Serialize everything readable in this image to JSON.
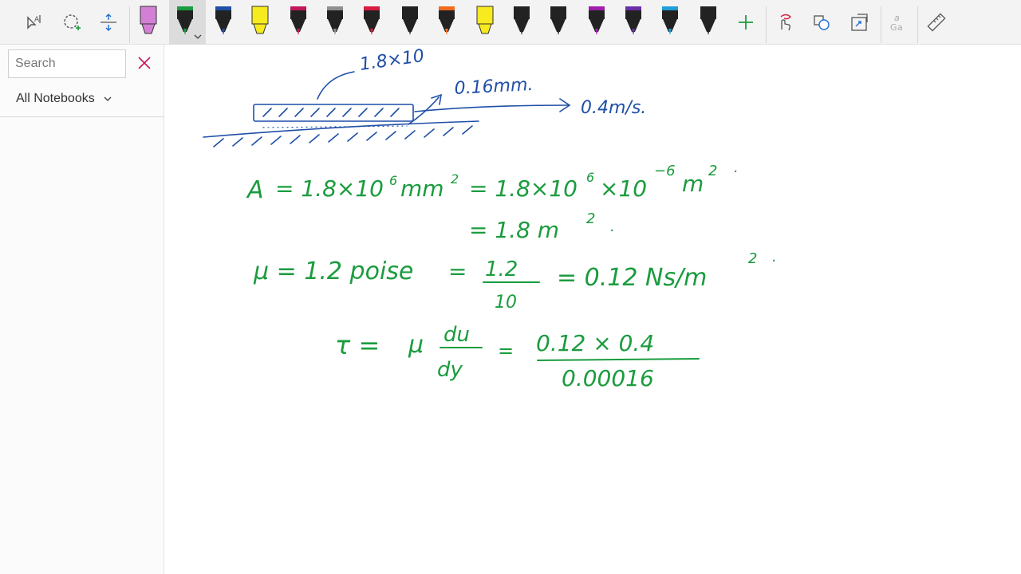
{
  "sidebar": {
    "search_placeholder": "Search",
    "notebook_filter_label": "All Notebooks"
  },
  "toolbar": {
    "tools": [
      "lasso-select-icon",
      "insert-space-icon",
      "add-space-icon",
      "add-pen-icon",
      "touch-draw-icon",
      "ink-to-shape-icon",
      "ink-to-text-icon",
      "ink-to-math-icon",
      "ruler-icon"
    ],
    "pens": [
      {
        "name": "highlighter-pink",
        "color": "#d47fd6"
      },
      {
        "name": "pen-green",
        "color": "#1a9c3e"
      },
      {
        "name": "pen-blue",
        "color": "#1f4fa8"
      },
      {
        "name": "highlighter-yellow",
        "color": "#f7ea1e"
      },
      {
        "name": "pen-magenta",
        "color": "#c2185b"
      },
      {
        "name": "pen-grey",
        "color": "#8f8f8f"
      },
      {
        "name": "pen-red",
        "color": "#d81b3f"
      },
      {
        "name": "pen-black",
        "color": "#222222"
      },
      {
        "name": "pen-orange",
        "color": "#f26b1d"
      },
      {
        "name": "highlighter-yellow-2",
        "color": "#f7ea1e"
      },
      {
        "name": "pen-black-2",
        "color": "#222222"
      },
      {
        "name": "pen-black-3",
        "color": "#222222"
      },
      {
        "name": "pen-purple",
        "color": "#a21caf"
      },
      {
        "name": "pen-violet",
        "color": "#6b2fa8"
      },
      {
        "name": "pen-cyan",
        "color": "#1e9fd8"
      },
      {
        "name": "pen-black-4",
        "color": "#222222"
      }
    ]
  },
  "notes": {
    "diagram_top_label": "1.8×10",
    "gap_label": "0.16mm.",
    "velocity_label": "0.4m/s.",
    "line1_lhs": "A",
    "line1_expr": "= 1.8×10",
    "line1_exp1": "6",
    "line1_unit": "mm",
    "line1_sq1": "2",
    "line1_eq2": "= 1.8×10",
    "line1_exp2": "6",
    "line1_times": "×10",
    "line1_exp3": "−6",
    "line1_unit2": "m",
    "line1_sq2": "2",
    "line1_end": ".",
    "line2_expr": "= 1.8 m",
    "line2_sq": "2",
    "line2_end": ".",
    "line3_lhs": "μ = 1.2 poise",
    "line3_eq": "=",
    "line3_num": "1.2",
    "line3_den": "10",
    "line3_result": "= 0.12 Ns/m",
    "line3_sq": "2",
    "line3_end": ".",
    "line4_lhs": "τ =",
    "line4_mu": "μ",
    "line4_du": "du",
    "line4_dy": "dy",
    "line4_eq": "=",
    "line4_num": "0.12 × 0.4",
    "line4_den": "0.00016"
  },
  "colors": {
    "ink_green": "#1a9c3e",
    "ink_blue": "#1f4fa8",
    "accent_purple": "#7a1fa2"
  }
}
